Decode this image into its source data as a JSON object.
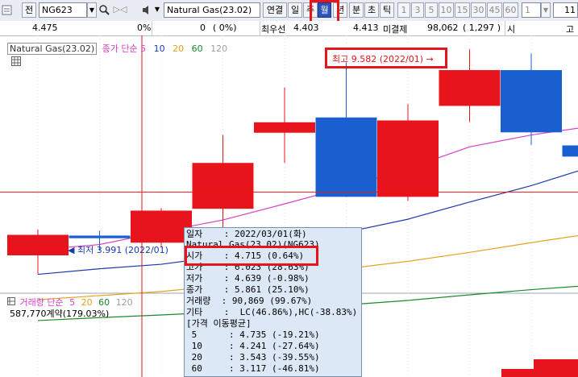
{
  "toolbar": {
    "market_label": "전",
    "code_value": "NG623",
    "product_name": "Natural Gas(23.02)",
    "link_label": "연결",
    "periods": [
      "일",
      "주",
      "월",
      "년",
      "분",
      "초",
      "틱"
    ],
    "selected_period": "월",
    "intervals": [
      "1",
      "3",
      "5",
      "10",
      "15",
      "30",
      "45",
      "60"
    ],
    "count_value": "1",
    "last_value": "11"
  },
  "infobar": {
    "last_price": "4.475",
    "change_pct": "0%",
    "volume": "0",
    "volume_pct": "( 0%)",
    "best_ask_label": "최우선",
    "best_ask_value": "4.403",
    "best_bid_value": "4.413",
    "open_interest_label": "미결제",
    "open_interest_value": "98,062",
    "open_interest_change": "( 1,297 )",
    "open_label": "시",
    "high_label": "고"
  },
  "price_panel": {
    "legend_product": "Natural Gas(23.02)",
    "legend_ma_title": "종가 단순",
    "ma_periods": [
      "5",
      "10",
      "20",
      "60",
      "120"
    ],
    "high_marker": "최고 9.582 (2022/01)",
    "low_marker": "최저 3.991 (2022/01)"
  },
  "volume_panel": {
    "legend_title": "거래량 단순",
    "ma_periods": [
      "5",
      "20",
      "60",
      "120"
    ],
    "value_text": "587,770계약(179.03%)"
  },
  "colors": {
    "up": "#e8141b",
    "down": "#1a5fd0",
    "ma5": "#d63fc2",
    "ma10": "#1c3aa8",
    "ma20": "#e6a21a",
    "ma60": "#1a8a2a",
    "highlight": "#e8141b"
  },
  "tooltip": {
    "lines": [
      "일자    : 2022/03/01(화)",
      "Natural Gas(23.02)(NG623)",
      "시가    : 4.715 (0.64%)",
      "고가    : 6.023 (28.63%)",
      "저가    : 4.639 (-0.98%)",
      "종가    : 5.861 (25.10%)",
      "거래량  : 90,869 (99.67%)",
      "기타    :  LC(46.86%),HC(-38.83%)",
      "[가격 이동평균]",
      " 5      : 4.735 (-19.21%)",
      " 10     : 4.241 (-27.64%)",
      " 20     : 3.543 (-39.55%)",
      " 60     : 3.117 (-46.81%)"
    ]
  },
  "chart_data": {
    "type": "candlestick",
    "ylim": [
      3.6,
      10.3
    ],
    "candles": [
      {
        "open": 4.95,
        "high": 5.09,
        "low": 3.9,
        "close": 4.4,
        "dir": "up"
      },
      {
        "open": 4.86,
        "high": 5.06,
        "low": 4.53,
        "close": 4.93,
        "dir": "down"
      },
      {
        "open": 4.74,
        "high": 5.67,
        "low": 4.62,
        "close": 5.6,
        "dir": "up"
      },
      {
        "open": 5.65,
        "high": 7.63,
        "low": 4.64,
        "close": 6.88,
        "dir": "up"
      },
      {
        "open": 7.69,
        "high": 8.9,
        "low": 6.88,
        "close": 7.97,
        "dir": "up"
      },
      {
        "open": 8.1,
        "high": 9.58,
        "low": 5.97,
        "close": 5.97,
        "dir": "down"
      },
      {
        "open": 5.97,
        "high": 8.46,
        "low": 5.86,
        "close": 8.02,
        "dir": "up"
      },
      {
        "open": 8.41,
        "high": 9.93,
        "low": 7.98,
        "close": 9.37,
        "dir": "up"
      },
      {
        "open": 9.37,
        "high": 9.82,
        "low": 7.36,
        "close": 7.7,
        "dir": "down"
      },
      {
        "open": 7.35,
        "high": 7.5,
        "low": 6.6,
        "close": 7.05,
        "dir": "down"
      }
    ],
    "ma5": [
      4.55,
      4.69,
      5.03,
      5.35,
      5.78,
      6.23,
      6.73,
      7.31,
      7.63,
      7.87
    ],
    "ma10": [
      3.89,
      4.04,
      4.16,
      4.38,
      4.73,
      5.02,
      5.37,
      5.83,
      6.27,
      6.79
    ],
    "ma20": [
      3.21,
      3.32,
      3.43,
      3.59,
      3.83,
      4.04,
      4.24,
      4.48,
      4.74,
      4.99
    ],
    "ma60": [
      2.65,
      2.73,
      2.8,
      2.88,
      2.97,
      3.07,
      3.19,
      3.34,
      3.48,
      3.6
    ],
    "crosshair_price": 6.1,
    "volume_bars": [
      {
        "value": 0.25,
        "dir": "up"
      },
      {
        "value": 0.55,
        "dir": "up"
      }
    ]
  }
}
